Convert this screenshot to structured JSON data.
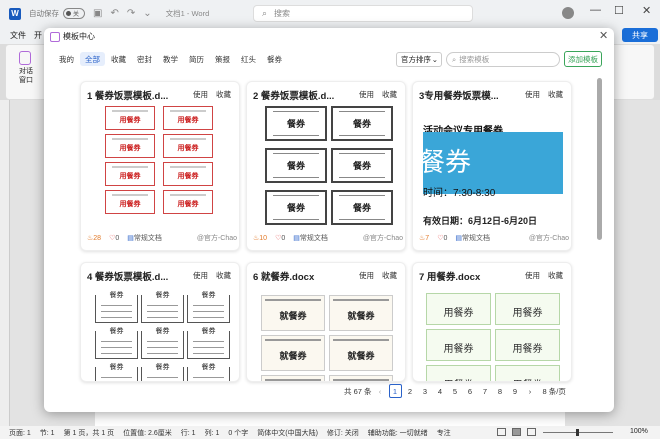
{
  "titlebar": {
    "app_icon": "W",
    "autosave_label": "自动保存",
    "toggle_text": "关",
    "doc_title": "文档1 - Word",
    "search_placeholder": "搜索",
    "minimize": "—",
    "maximize": "☐",
    "close": "✕"
  },
  "menubar": {
    "file": "文件",
    "second": "开",
    "share": "共享"
  },
  "ribbon": {
    "dialog_label_1": "对话",
    "dialog_label_2": "窗口"
  },
  "modal": {
    "title": "模板中心",
    "close": "✕",
    "tabs": [
      "我的",
      "全部",
      "收藏",
      "密封",
      "教学",
      "简历",
      "策报",
      "红头",
      "餐券"
    ],
    "active_tab": "全部",
    "sort_label": "官方排序",
    "search_placeholder": "搜索模板",
    "add_button": "添加模板",
    "use_label": "使用",
    "fav_label": "收藏",
    "cards": [
      {
        "title": "1 餐券饭票模板.d...",
        "hot": "28",
        "likes": "0",
        "tag": "常规文档",
        "author": "@官方-Chao"
      },
      {
        "title": "2 餐券饭票模板.d...",
        "hot": "10",
        "likes": "0",
        "tag": "常规文档",
        "author": "@官方-Chao"
      },
      {
        "title": "3专用餐券饭票模...",
        "hot": "7",
        "likes": "0",
        "tag": "常规文档",
        "author": "@官方-Chao"
      },
      {
        "title": "4 餐券饭票模板.d...",
        "hot": "",
        "likes": "",
        "tag": "",
        "author": ""
      },
      {
        "title": "6 就餐券.docx",
        "hot": "",
        "likes": "",
        "tag": "",
        "author": ""
      },
      {
        "title": "7 用餐券.docx",
        "hot": "",
        "likes": "",
        "tag": "",
        "author": ""
      }
    ],
    "thumb_text": {
      "red": "用餐券",
      "gray": "餐券",
      "blue_line1": "活动会议专用餐券",
      "blue_line2": "餐券",
      "blue_line3": "时间：7:30-8:30",
      "blue_line4": "有效日期：6月12日-6月20日",
      "bw": "餐券",
      "beige": "就餐券",
      "floral": "用餐券"
    },
    "pager": {
      "total": "共 67 条",
      "prev": "‹",
      "pages": [
        "1",
        "2",
        "3",
        "4",
        "5",
        "6",
        "7",
        "8",
        "9"
      ],
      "current": "1",
      "next": "›",
      "per_page": "8 条/页"
    }
  },
  "statusbar": {
    "items": [
      "页面: 1",
      "节: 1",
      "第 1 页，共 1 页",
      "位置值: 2.6厘米",
      "行: 1",
      "列: 1",
      "0 个字",
      "简体中文(中国大陆)",
      "修订: 关闭",
      "辅助功能: 一切就绪",
      "专注"
    ],
    "zoom": "100%"
  }
}
